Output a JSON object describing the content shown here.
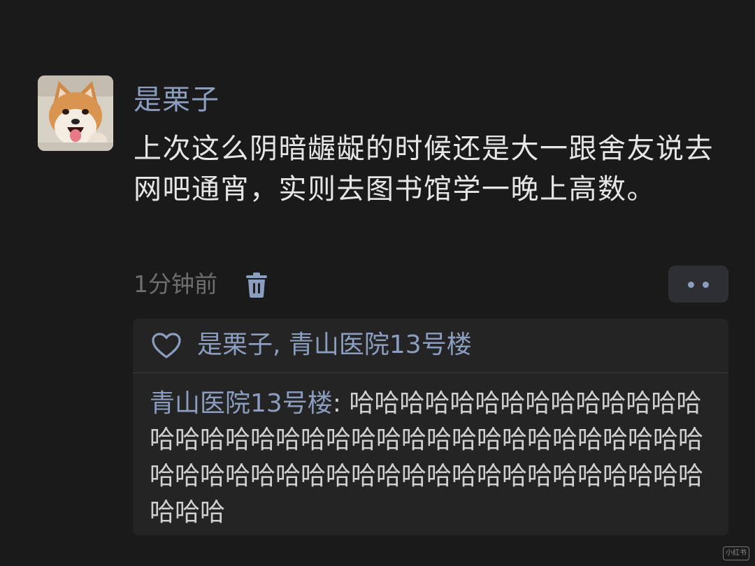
{
  "post": {
    "username": "是栗子",
    "text": "上次这么阴暗龌龊的时候还是大一跟舍友说去网吧通宵，实则去图书馆学一晚上高数。",
    "timestamp": "1分钟前",
    "delete_icon": "trash-icon",
    "more_icon": "more-dots-icon"
  },
  "likes": {
    "icon": "heart-outline-icon",
    "names": "是栗子, 青山医院13号楼"
  },
  "comments": [
    {
      "author": "青山医院13号楼",
      "separator": ": ",
      "text": "哈哈哈哈哈哈哈哈哈哈哈哈哈哈哈哈哈哈哈哈哈哈哈哈哈哈哈哈哈哈哈哈哈哈哈哈哈哈哈哈哈哈哈哈哈哈哈哈哈哈哈哈哈哈哈哈哈哈哈哈哈"
    }
  ],
  "watermark": {
    "text": "小红书"
  },
  "colors": {
    "background": "#1a1a1a",
    "panel": "#242424",
    "link_blue": "#8b9ec0",
    "text_primary": "#e6e6e6",
    "text_secondary": "#6e6e6e"
  }
}
